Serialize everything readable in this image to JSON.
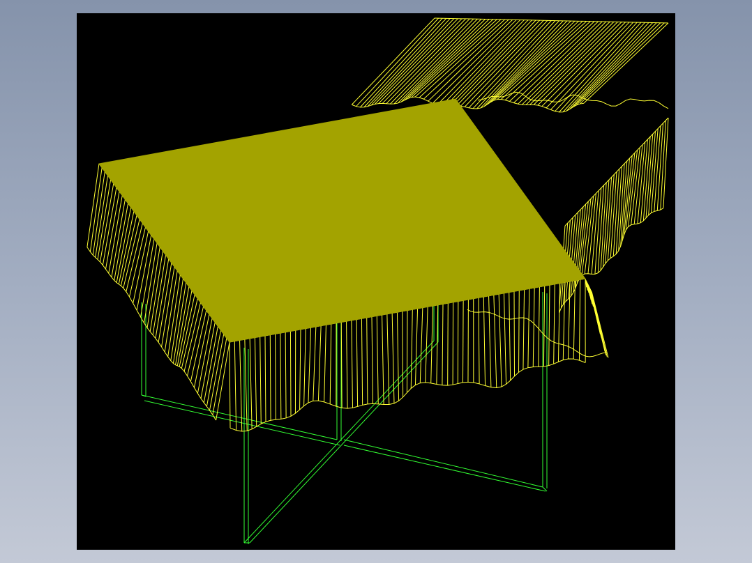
{
  "viewport": {
    "background": "#000000",
    "window_background_top": "#8593ab",
    "window_background_bottom": "#c3c9d6"
  },
  "model": {
    "description_icon": "wireframe-table-with-tablecloth",
    "tablecloth_color": "#ffff33",
    "tabletop_fill": "#a3a300",
    "frame_color": "#33ff33"
  }
}
